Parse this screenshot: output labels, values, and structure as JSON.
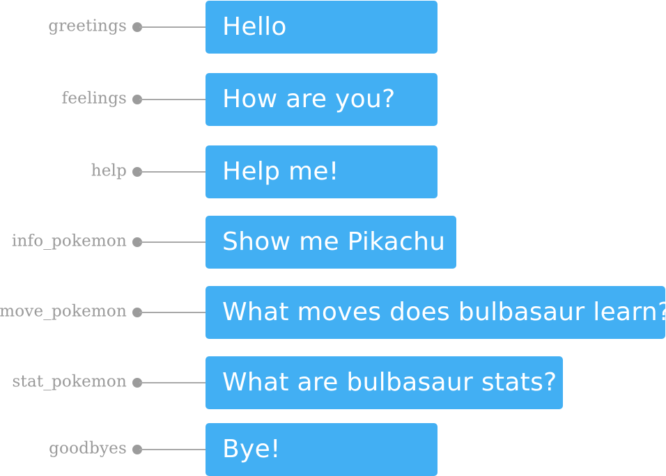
{
  "rows": [
    {
      "intent": "greetings",
      "utterance": "Hello"
    },
    {
      "intent": "feelings",
      "utterance": "How are you?"
    },
    {
      "intent": "help",
      "utterance": "Help me!"
    },
    {
      "intent": "info_pokemon",
      "utterance": "Show me Pikachu"
    },
    {
      "intent": "move_pokemon",
      "utterance": "What moves does bulbasaur learn?"
    },
    {
      "intent": "stat_pokemon",
      "utterance": "What are bulbasaur stats?"
    },
    {
      "intent": "goodbyes",
      "utterance": "Bye!"
    }
  ],
  "colors": {
    "bubble": "#42aff3",
    "label": "#9a9a9a",
    "connector": "#9b9b9b"
  }
}
